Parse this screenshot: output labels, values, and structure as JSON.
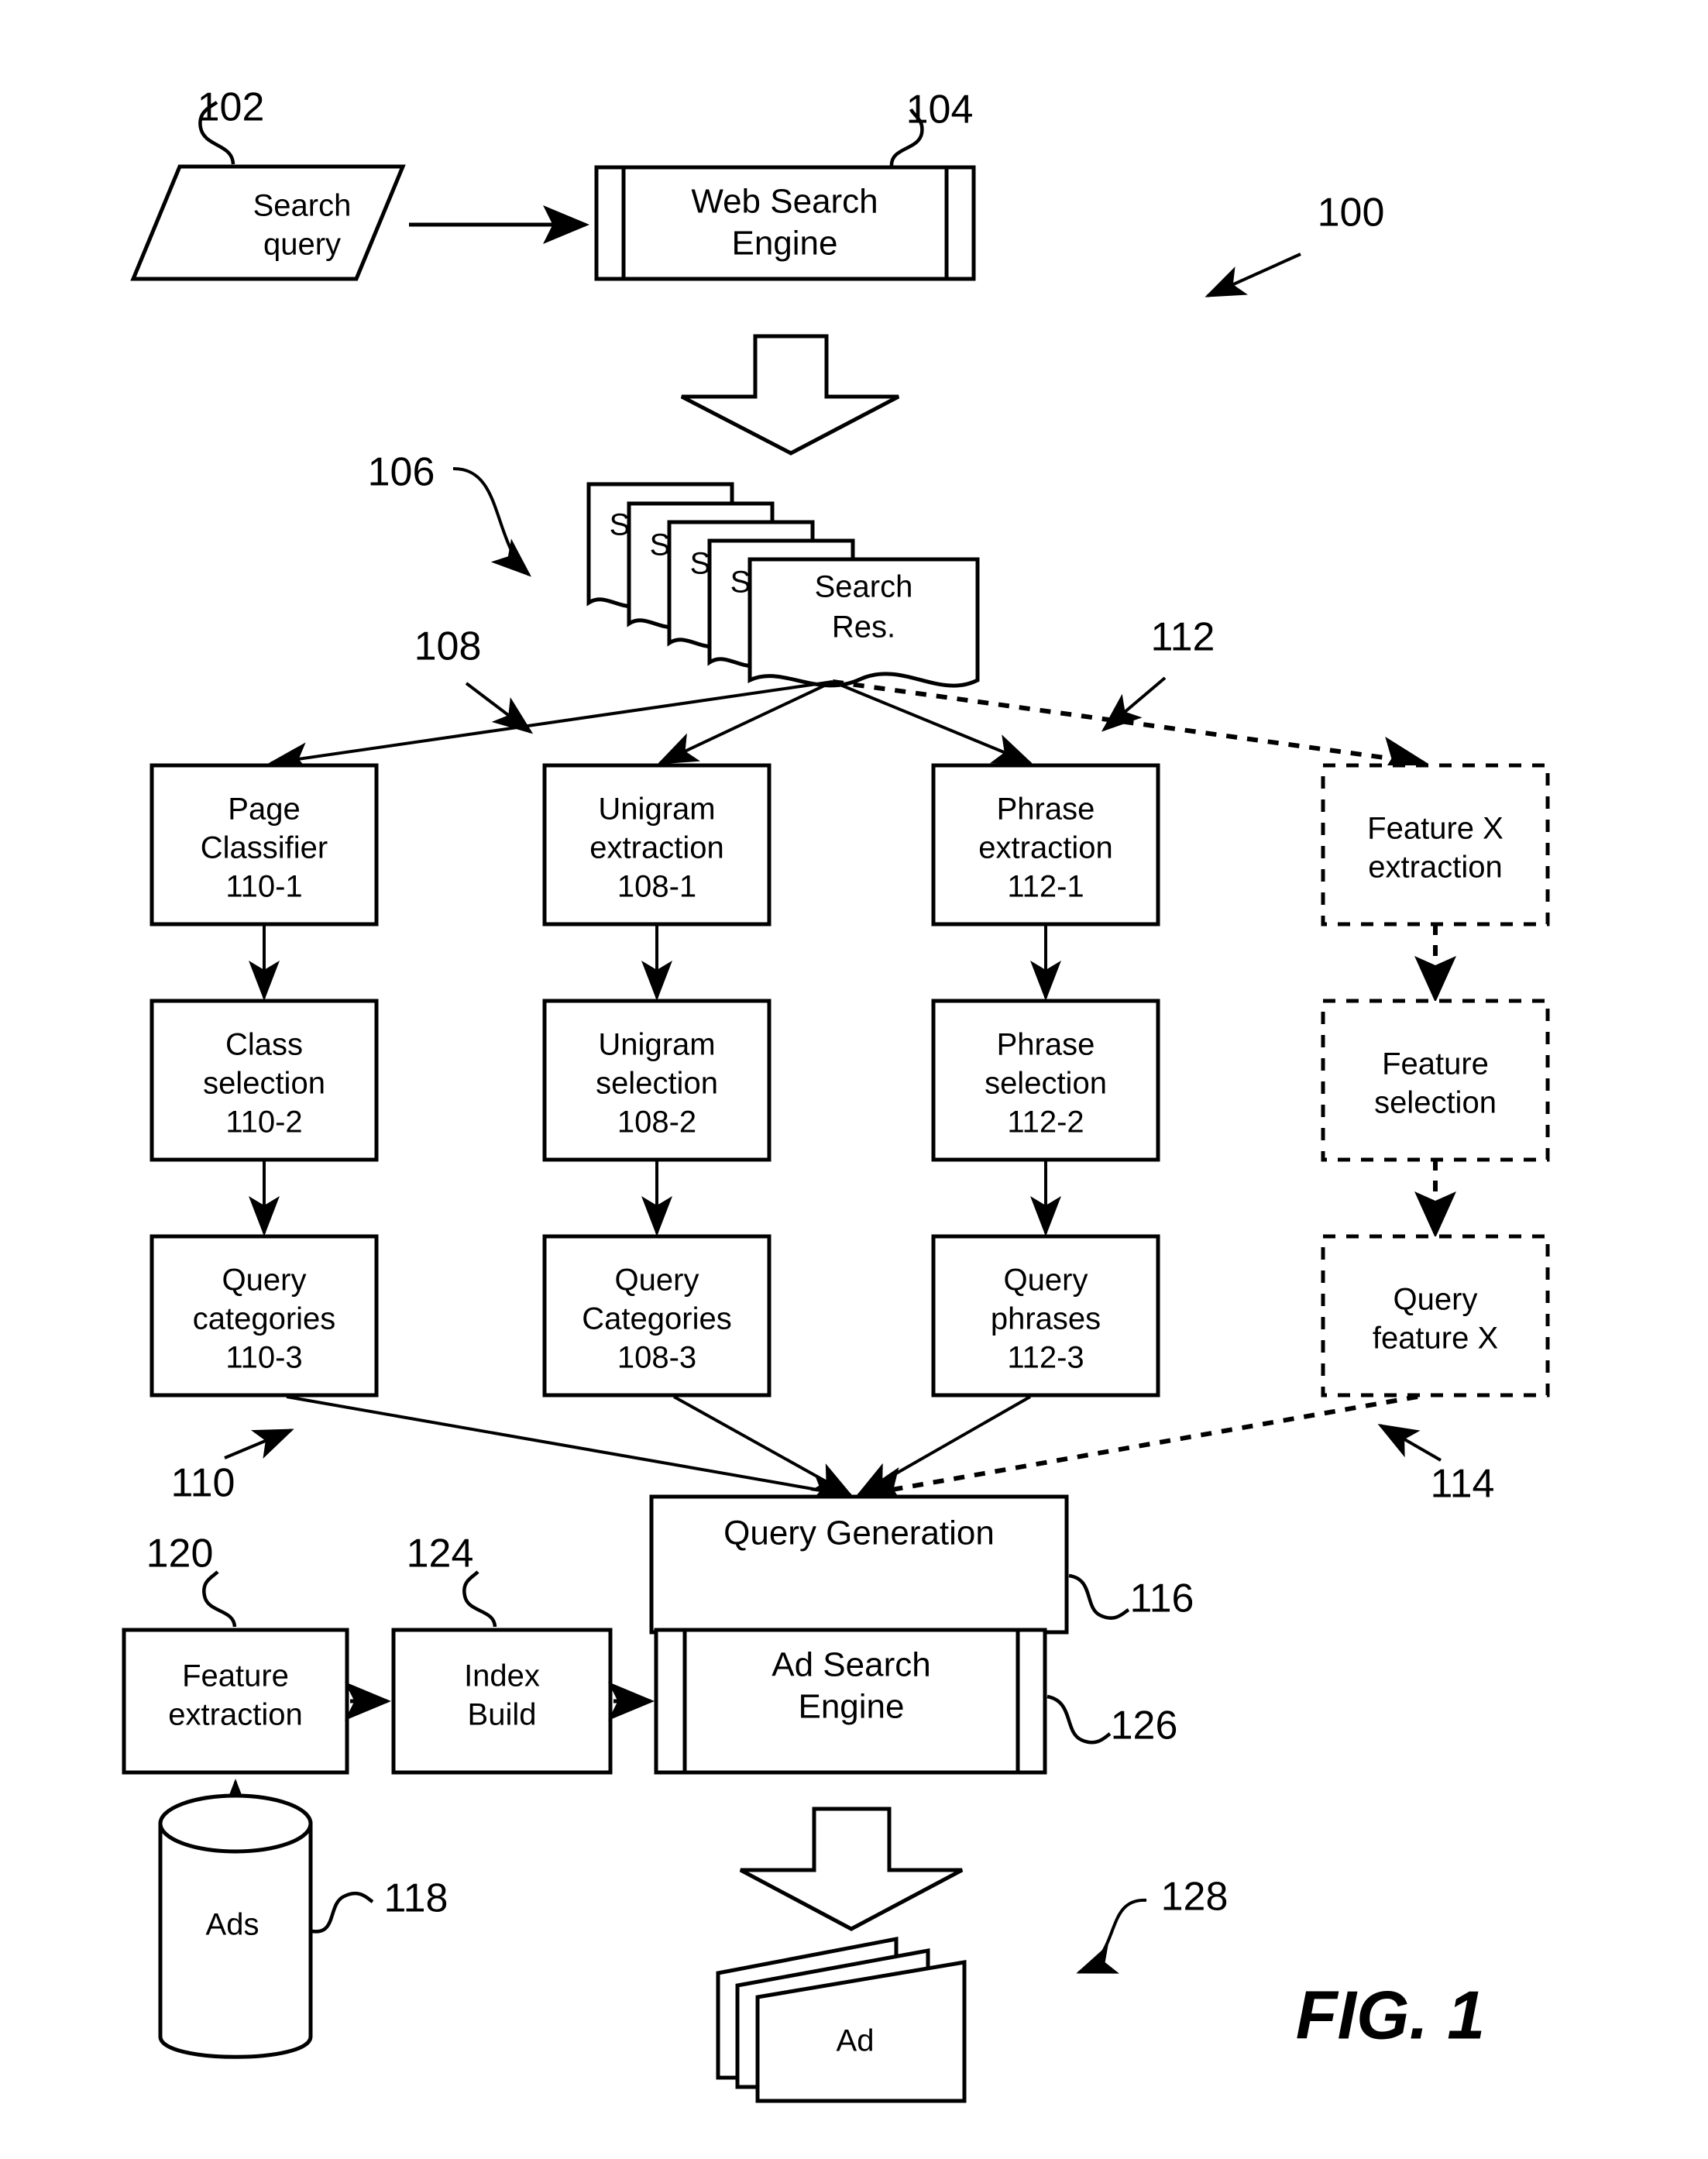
{
  "figure": {
    "caption": "FIG. 1",
    "system_ref": "100"
  },
  "nodes": {
    "search_query": {
      "label_line1": "Search",
      "label_line2": "query",
      "ref": "102"
    },
    "web_search_engine": {
      "label_line1": "Web Search",
      "label_line2": "Engine",
      "ref": "104"
    },
    "search_results": {
      "label_line1": "Search",
      "label_line2": "Res.",
      "partial_label": "S",
      "ref": "106",
      "stack_count": 5
    },
    "page_classifier": {
      "label_line1": "Page",
      "label_line2": "Classifier",
      "label_line3": "110-1"
    },
    "unigram_extraction": {
      "label_line1": "Unigram",
      "label_line2": "extraction",
      "label_line3": "108-1"
    },
    "phrase_extraction": {
      "label_line1": "Phrase",
      "label_line2": "extraction",
      "label_line3": "112-1"
    },
    "feature_x_extraction": {
      "label_line1": "Feature X",
      "label_line2": "extraction"
    },
    "class_selection": {
      "label_line1": "Class",
      "label_line2": "selection",
      "label_line3": "110-2"
    },
    "unigram_selection": {
      "label_line1": "Unigram",
      "label_line2": "selection",
      "label_line3": "108-2"
    },
    "phrase_selection": {
      "label_line1": "Phrase",
      "label_line2": "selection",
      "label_line3": "112-2"
    },
    "feature_selection": {
      "label_line1": "Feature",
      "label_line2": "selection"
    },
    "query_categories_110": {
      "label_line1": "Query",
      "label_line2": "categories",
      "label_line3": "110-3"
    },
    "query_categories_108": {
      "label_line1": "Query",
      "label_line2": "Categories",
      "label_line3": "108-3"
    },
    "query_phrases_112": {
      "label_line1": "Query",
      "label_line2": "phrases",
      "label_line3": "112-3"
    },
    "query_feature_x": {
      "label_line1": "Query",
      "label_line2": "feature X"
    },
    "query_generation": {
      "label_line1": "Query Generation",
      "ref": "116"
    },
    "feature_extraction": {
      "label_line1": "Feature",
      "label_line2": "extraction",
      "ref": "120"
    },
    "index_build": {
      "label_line1": "Index",
      "label_line2": "Build",
      "ref": "124"
    },
    "ad_search_engine": {
      "label_line1": "Ad Search",
      "label_line2": "Engine",
      "ref": "126"
    },
    "ads_store": {
      "label_line1": "Ads",
      "ref": "118"
    },
    "ad_output": {
      "label_line1": "Ad",
      "ref": "128",
      "stack_count": 3
    }
  },
  "branch_refs": {
    "classifier_branch": "108",
    "phrase_branch": "112",
    "category_branch": "110",
    "feature_branch": "114"
  },
  "colors": {
    "stroke": "#000000",
    "background": "#ffffff"
  },
  "icons": {
    "big_arrow_down": "hollow-down-arrow",
    "database": "cylinder-icon",
    "document_stack": "document-stack-icon"
  }
}
